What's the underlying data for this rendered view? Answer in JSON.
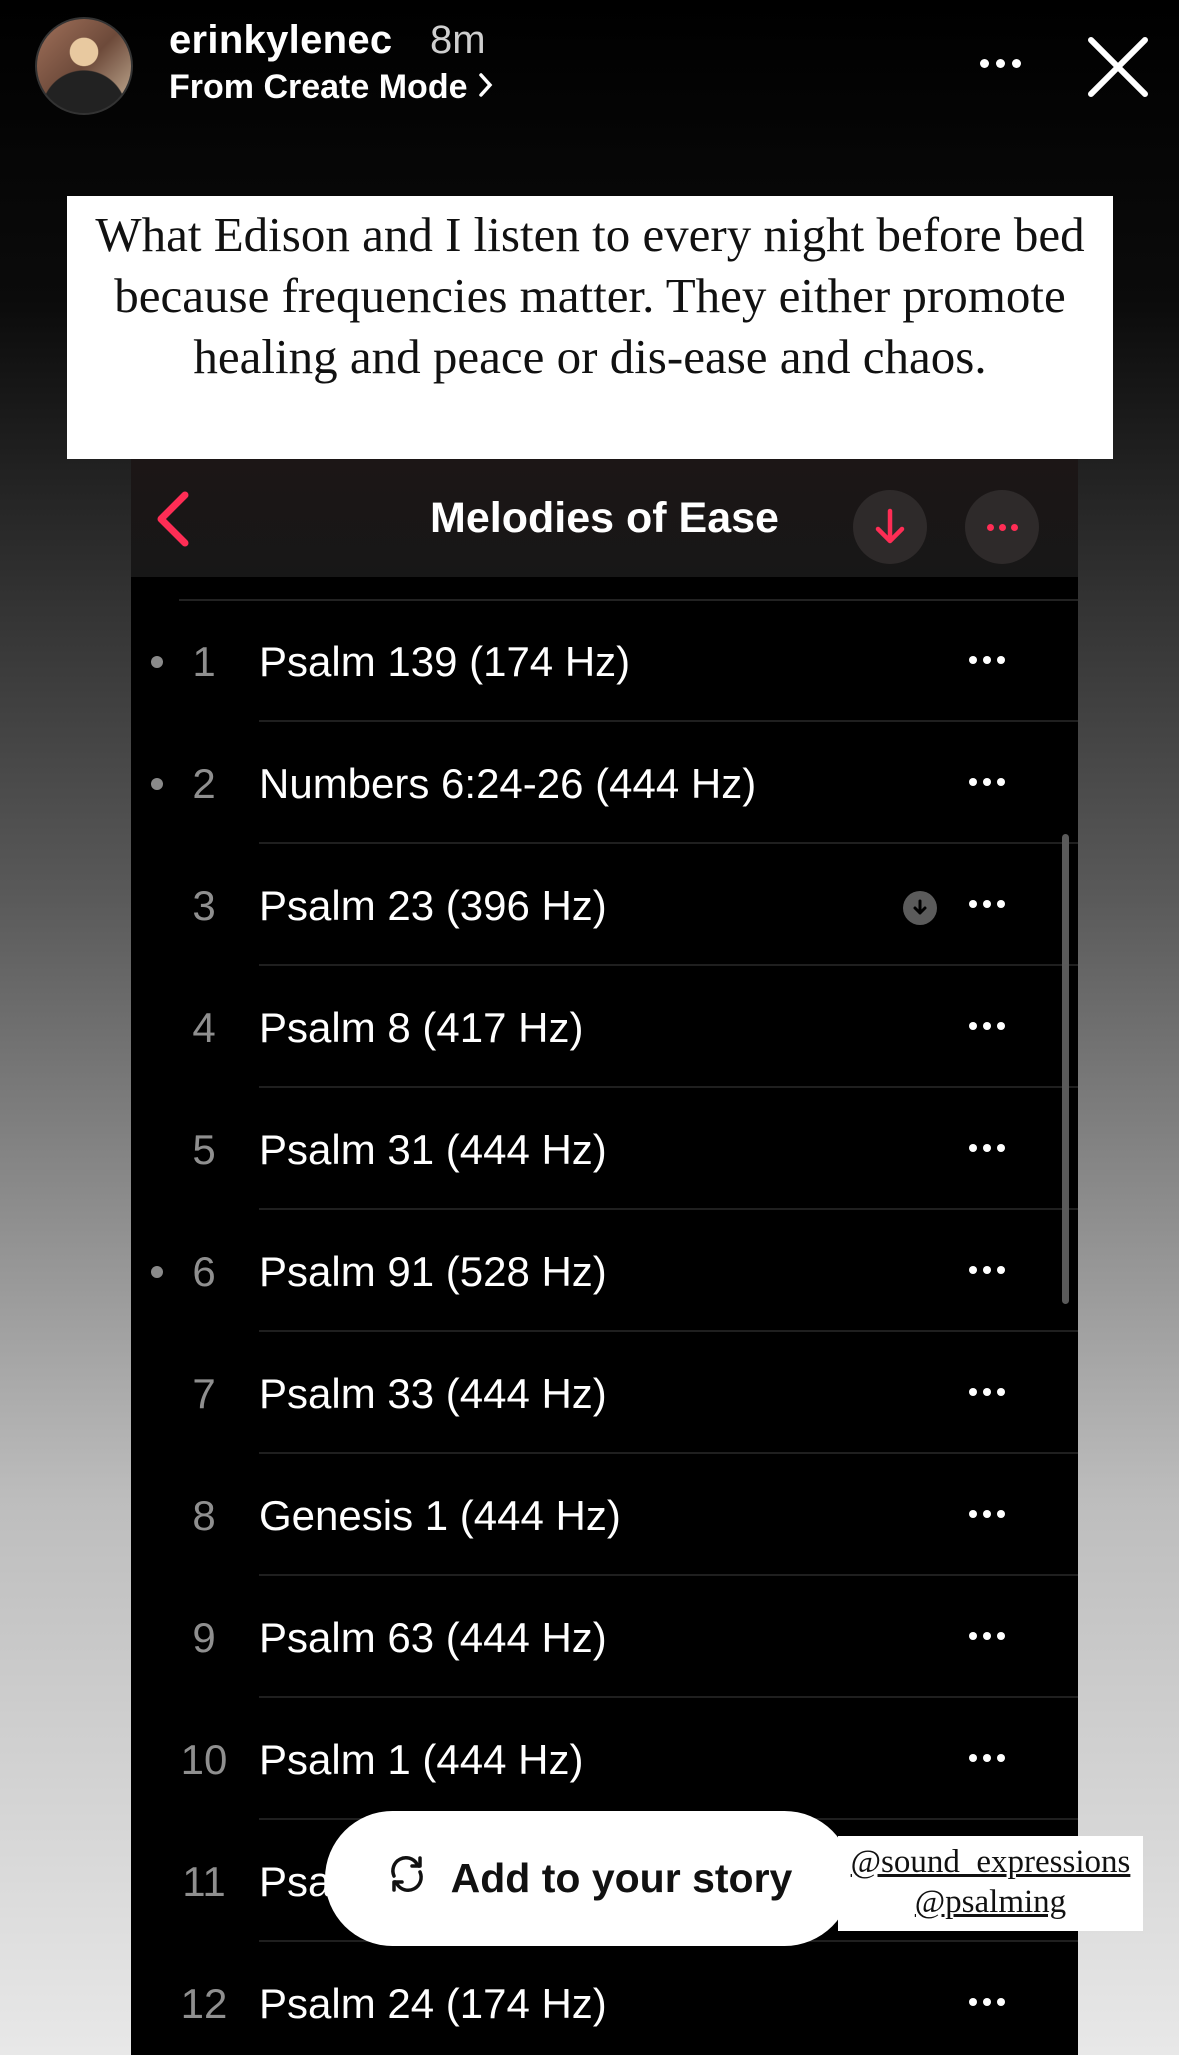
{
  "story": {
    "username": "erinkylenec",
    "time": "8m",
    "source": "From Create Mode",
    "caption": "What Edison and I listen to every night before bed because frequencies matter. They either promote healing and peace or dis-ease and chaos.",
    "add_to_story_label": "Add to your story",
    "mentions": [
      "@sound_expressions",
      "@psalming"
    ]
  },
  "music": {
    "title": "Melodies of Ease",
    "accent_color": "#ff2d55",
    "tracks": [
      {
        "number": "1",
        "title": "Psalm 139 (174 Hz)",
        "played": true
      },
      {
        "number": "2",
        "title": "Numbers 6:24-26 (444 Hz)",
        "played": true
      },
      {
        "number": "3",
        "title": "Psalm 23 (396 Hz)",
        "downloaded": true
      },
      {
        "number": "4",
        "title": "Psalm 8 (417 Hz)"
      },
      {
        "number": "5",
        "title": "Psalm 31 (444 Hz)"
      },
      {
        "number": "6",
        "title": "Psalm 91 (528 Hz)",
        "played": true
      },
      {
        "number": "7",
        "title": "Psalm 33 (444 Hz)"
      },
      {
        "number": "8",
        "title": "Genesis 1 (444 Hz)"
      },
      {
        "number": "9",
        "title": "Psalm 63 (444 Hz)"
      },
      {
        "number": "10",
        "title": "Psalm 1 (444 Hz)"
      },
      {
        "number": "11",
        "title": "Psa"
      },
      {
        "number": "12",
        "title": "Psalm 24 (174 Hz)"
      }
    ]
  }
}
